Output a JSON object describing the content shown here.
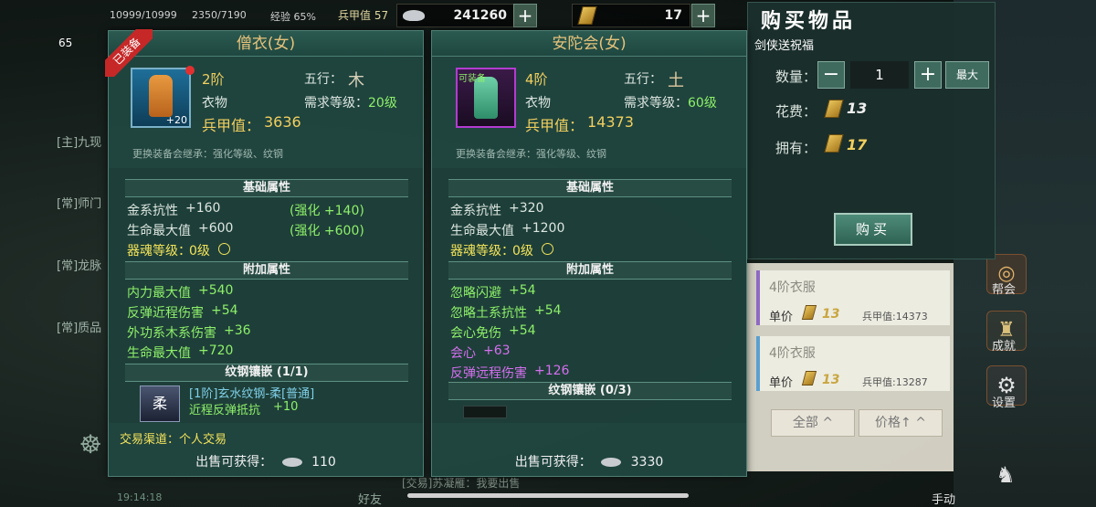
{
  "hud": {
    "hp": "10999/10999",
    "mp": "2350/7190",
    "exp": "经验 65%",
    "level": "65",
    "armor_label": "兵甲值 57",
    "silver": "241260",
    "gold_bars": "17"
  },
  "left_panel": {
    "badge": "已装备",
    "title": "僧衣(女)",
    "tier": "2阶",
    "five_elem_label": "五行：",
    "five_elem_value": "木",
    "type": "衣物",
    "req_level_label": "需求等级：",
    "req_level_value": "20级",
    "armor_label": "兵甲值：",
    "armor_value": "3636",
    "icon_plus": "+20",
    "note": "更换装备会继承：强化等级、纹钢",
    "base_header": "基础属性",
    "base_attrs": [
      {
        "name": "金系抗性",
        "value": "+160",
        "enh": "(强化 +140)"
      },
      {
        "name": "生命最大值",
        "value": "+600",
        "enh": "(强化 +600)"
      }
    ],
    "soul_label": "器魂等级：",
    "soul_value": "0级",
    "extra_header": "附加属性",
    "extra_attrs": [
      {
        "name": "内力最大值",
        "value": "+540"
      },
      {
        "name": "反弹近程伤害",
        "value": "+54"
      },
      {
        "name": "外功系木系伤害",
        "value": "+36"
      },
      {
        "name": "生命最大值",
        "value": "+720"
      }
    ],
    "inlay_header": "纹钢镶嵌 (1/1)",
    "inlay_name": "[1阶]玄水纹钢-柔[普通]",
    "inlay_attr": "近程反弹抵抗",
    "inlay_value": "+10",
    "trade": "交易渠道：个人交易",
    "sell_label": "出售可获得：",
    "sell_value": "110"
  },
  "right_panel": {
    "title": "安陀会(女)",
    "badge": "可装备",
    "tier": "4阶",
    "five_elem_label": "五行：",
    "five_elem_value": "土",
    "type": "衣物",
    "req_level_label": "需求等级：",
    "req_level_value": "60级",
    "armor_label": "兵甲值：",
    "armor_value": "14373",
    "note": "更换装备会继承：强化等级、纹钢",
    "base_header": "基础属性",
    "base_attrs": [
      {
        "name": "金系抗性",
        "value": "+320"
      },
      {
        "name": "生命最大值",
        "value": "+1200"
      }
    ],
    "soul_label": "器魂等级：",
    "soul_value": "0级",
    "extra_header": "附加属性",
    "extra_attrs": [
      {
        "name": "忽略闪避",
        "value": "+54",
        "color": "green"
      },
      {
        "name": "忽略土系抗性",
        "value": "+54",
        "color": "green"
      },
      {
        "name": "会心免伤",
        "value": "+54",
        "color": "green"
      },
      {
        "name": "会心",
        "value": "+63",
        "color": "purple"
      },
      {
        "name": "反弹远程伤害",
        "value": "+126",
        "color": "purple"
      }
    ],
    "inlay_header": "纹钢镶嵌 (0/3)",
    "sell_label": "出售可获得：",
    "sell_value": "3330"
  },
  "buy": {
    "title": "购买物品",
    "announce": "普天同庆，剑侠送祝福",
    "qty_label": "数量：",
    "qty_value": "1",
    "minus": "−",
    "plus": "+",
    "max": "最大",
    "cost_label": "花费：",
    "cost_value": "13",
    "own_label": "拥有：",
    "own_value": "17",
    "buy_btn": "购买"
  },
  "shop_list": [
    {
      "name": "4阶衣服",
      "price_label": "单价",
      "price": "13",
      "armor": "兵甲值:14373"
    },
    {
      "name": "4阶衣服",
      "price_label": "单价",
      "price": "13",
      "armor": "兵甲值:13287"
    }
  ],
  "filters": {
    "all": "全部",
    "price": "价格↑"
  },
  "side_buttons": {
    "help": "帮会",
    "growth": "成就",
    "settings": "设置",
    "hand": "手动"
  },
  "chat": {
    "line1": "[主]九现",
    "line2": "[常]师门",
    "line3": "[常]龙脉",
    "line4": "[常]质品",
    "friends": "好友",
    "time": "19:14:18",
    "bottom_msg": "[交易]苏凝雁：我要出售"
  },
  "colors": {
    "panel": "#20463f",
    "gold": "#f2cf5e",
    "green": "#8ef06a",
    "purple": "#d56ef0"
  }
}
